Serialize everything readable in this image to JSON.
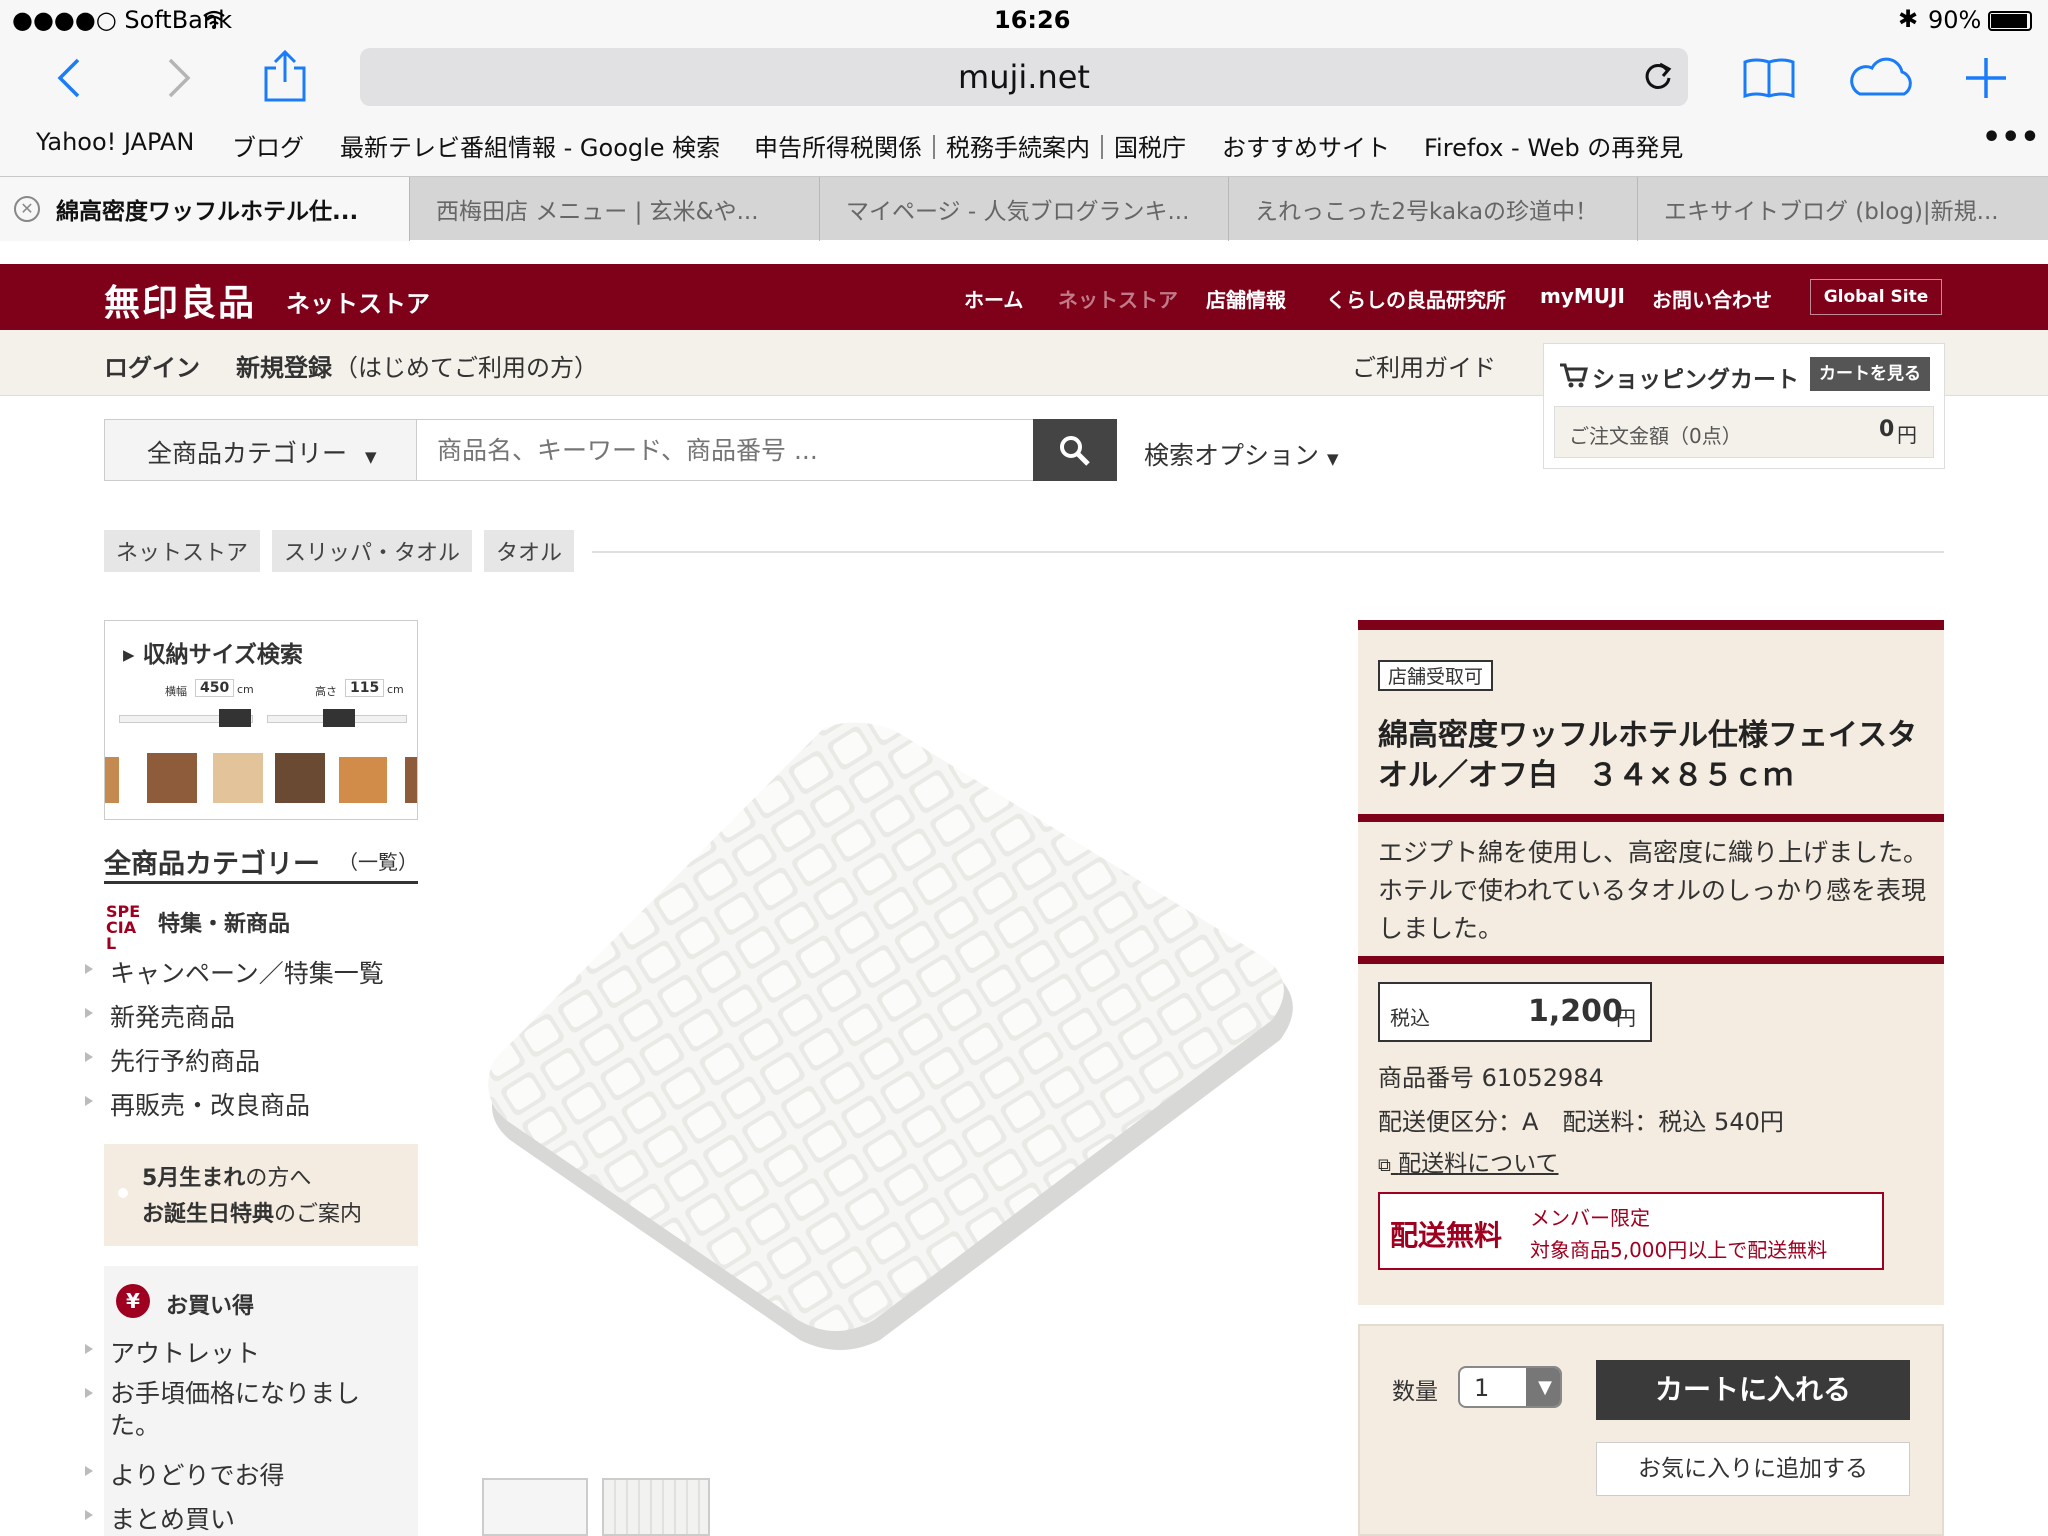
{
  "status": {
    "carrier": "●●●●○ SoftBank",
    "time": "16:26",
    "battery": "90%"
  },
  "browser": {
    "url": "muji.net",
    "bookmarks": [
      "Yahoo! JAPAN",
      "ブログ",
      "最新テレビ番組情報 - Google 検索",
      "申告所得税関係｜税務手続案内｜国税庁",
      "おすすめサイト",
      "Firefox - Web の再発見"
    ],
    "tabs": [
      "綿高密度ワッフルホテル仕...",
      "西梅田店 メニュー | 玄米&や...",
      "マイページ - 人気ブログランキ...",
      "えれっこった2号kakaの珍道中！",
      "エキサイトブログ (blog)|新規..."
    ]
  },
  "header": {
    "logo": "無印良品",
    "logo_sub": "ネットストア",
    "nav": [
      "ホーム",
      "ネットストア",
      "店舗情報",
      "くらしの良品研究所",
      "myMUJI",
      "お問い合わせ"
    ],
    "global": "Global Site",
    "login": "ログイン",
    "register": "新規登録",
    "register_note": "（はじめてご利用の方）",
    "guide": "ご利用ガイド"
  },
  "search": {
    "category": "全商品カテゴリー",
    "placeholder": "商品名、キーワード、商品番号 ...",
    "options": "検索オプション"
  },
  "cart": {
    "title": "ショッピングカート",
    "view": "カートを見る",
    "amount_label": "ご注文金額（0点）",
    "amount": "0",
    "yen": "円"
  },
  "breadcrumb": [
    "ネットストア",
    "スリッパ・タオル",
    "タオル"
  ],
  "sidebar": {
    "storage_title": "収納サイズ検索",
    "width_label": "横幅",
    "width_value": "450",
    "height_label": "高さ",
    "height_value": "115",
    "unit": "cm",
    "category_title": "全商品カテゴリー",
    "category_note": "（一覧）",
    "special_icon": "SPE CIAL",
    "special_title": "特集・新商品",
    "special_items": [
      "キャンペーン／特集一覧",
      "新発売商品",
      "先行予約商品",
      "再販売・改良商品"
    ],
    "birthday_line1a": "5月生まれ",
    "birthday_line1b": "の方へ",
    "birthday_line2a": "お誕生日特典",
    "birthday_line2b": "のご案内",
    "deal_icon": "¥",
    "deal_title": "お買い得",
    "deal_items": [
      "アウトレット",
      "お手頃価格になりました。",
      "よりどりでお得",
      "まとめ買い"
    ]
  },
  "product": {
    "badge": "店舗受取可",
    "title": "綿高密度ワッフルホテル仕様フェイスタオル／オフ白　３４×８５ｃｍ",
    "description": "エジプト綿を使用し、高密度に織り上げました。ホテルで使われているタオルのしっかり感を表現しました。",
    "tax_label": "税込",
    "price": "1,200",
    "yen": "円",
    "code": "商品番号 61052984",
    "shipping": "配送便区分：A　配送料：税込 540円",
    "shipping_link": "配送料について",
    "free_title": "配送無料",
    "free_line1": "メンバー限定",
    "free_line2": "対象商品5,000円以上で配送無料",
    "qty_label": "数量",
    "qty_value": "1",
    "add_cart": "カートに入れる",
    "add_fav": "お気に入りに追加する"
  }
}
